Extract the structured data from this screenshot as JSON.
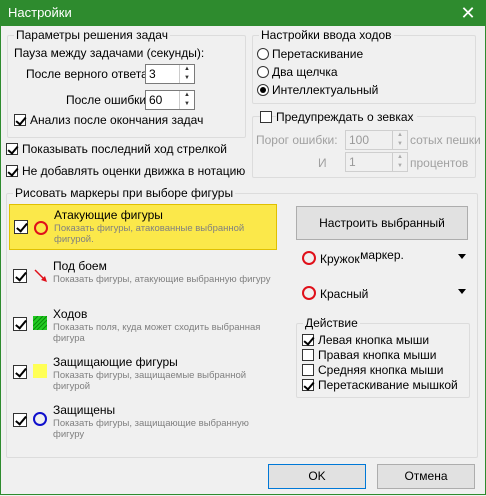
{
  "window": {
    "title": "Настройки"
  },
  "task_params": {
    "legend": "Параметры решения задач",
    "pause_label": "Пауза между задачами (секунды):",
    "after_correct_label": "После верного ответа:",
    "after_correct_value": "3",
    "after_error_label": "После ошибки:",
    "after_error_value": "60",
    "analysis_label": "Анализ после окончания задач"
  },
  "move_input": {
    "legend": "Настройки ввода ходов",
    "options": [
      "Перетаскивание",
      "Два щелчка",
      "Интеллектуальный"
    ],
    "selected": "Интеллектуальный"
  },
  "blunder": {
    "label": "Предупреждать о зевках",
    "threshold_label": "Порог ошибки:",
    "threshold_value": "100",
    "threshold_unit": "сотых пешки",
    "and_label": "И",
    "and_value": "1",
    "and_unit": "процентов"
  },
  "options": {
    "show_last_move": "Показывать последний ход стрелкой",
    "no_eval_notation": "Не добавлять оценки движка в нотацию"
  },
  "markers": {
    "legend": "Рисовать маркеры при выборе фигуры",
    "items": [
      {
        "title": "Атакующие фигуры",
        "desc": "Показать фигуры, атакованные выбранной фигурой.",
        "icon": "red-circle-icon"
      },
      {
        "title": "Под боем",
        "desc": "Показать фигуры, атакующие выбранную фигуру",
        "icon": "red-arrow-icon"
      },
      {
        "title": "Ходов",
        "desc": "Показать поля, куда может сходить выбранная фигура",
        "icon": "green-hatched-square-icon"
      },
      {
        "title": "Защищающие фигуры",
        "desc": "Показать фигуры, защищаемые выбранной фигурой",
        "icon": "yellow-square-icon"
      },
      {
        "title": "Защищены",
        "desc": "Показать фигуры, защищающие выбранную фигуру",
        "icon": "blue-circle-icon"
      }
    ],
    "configure_button": "Настроить выбранный маркер.",
    "shape_value": "Кружок",
    "color_value": "Красный"
  },
  "action": {
    "legend": "Действие",
    "items": [
      "Левая кнопка мыши",
      "Правая кнопка мыши",
      "Средняя кнопка мыши",
      "Перетаскивание мышкой"
    ],
    "checked": [
      true,
      false,
      false,
      true
    ]
  },
  "buttons": {
    "ok": "OK",
    "cancel": "Отмена"
  },
  "colors": {
    "title_bar": "#2e8b2e",
    "selected_item": "#fbe84a",
    "marker_red": "#e0101a",
    "marker_green": "#22cc22",
    "marker_yellow": "#ffff55",
    "marker_blue": "#1010cc"
  }
}
